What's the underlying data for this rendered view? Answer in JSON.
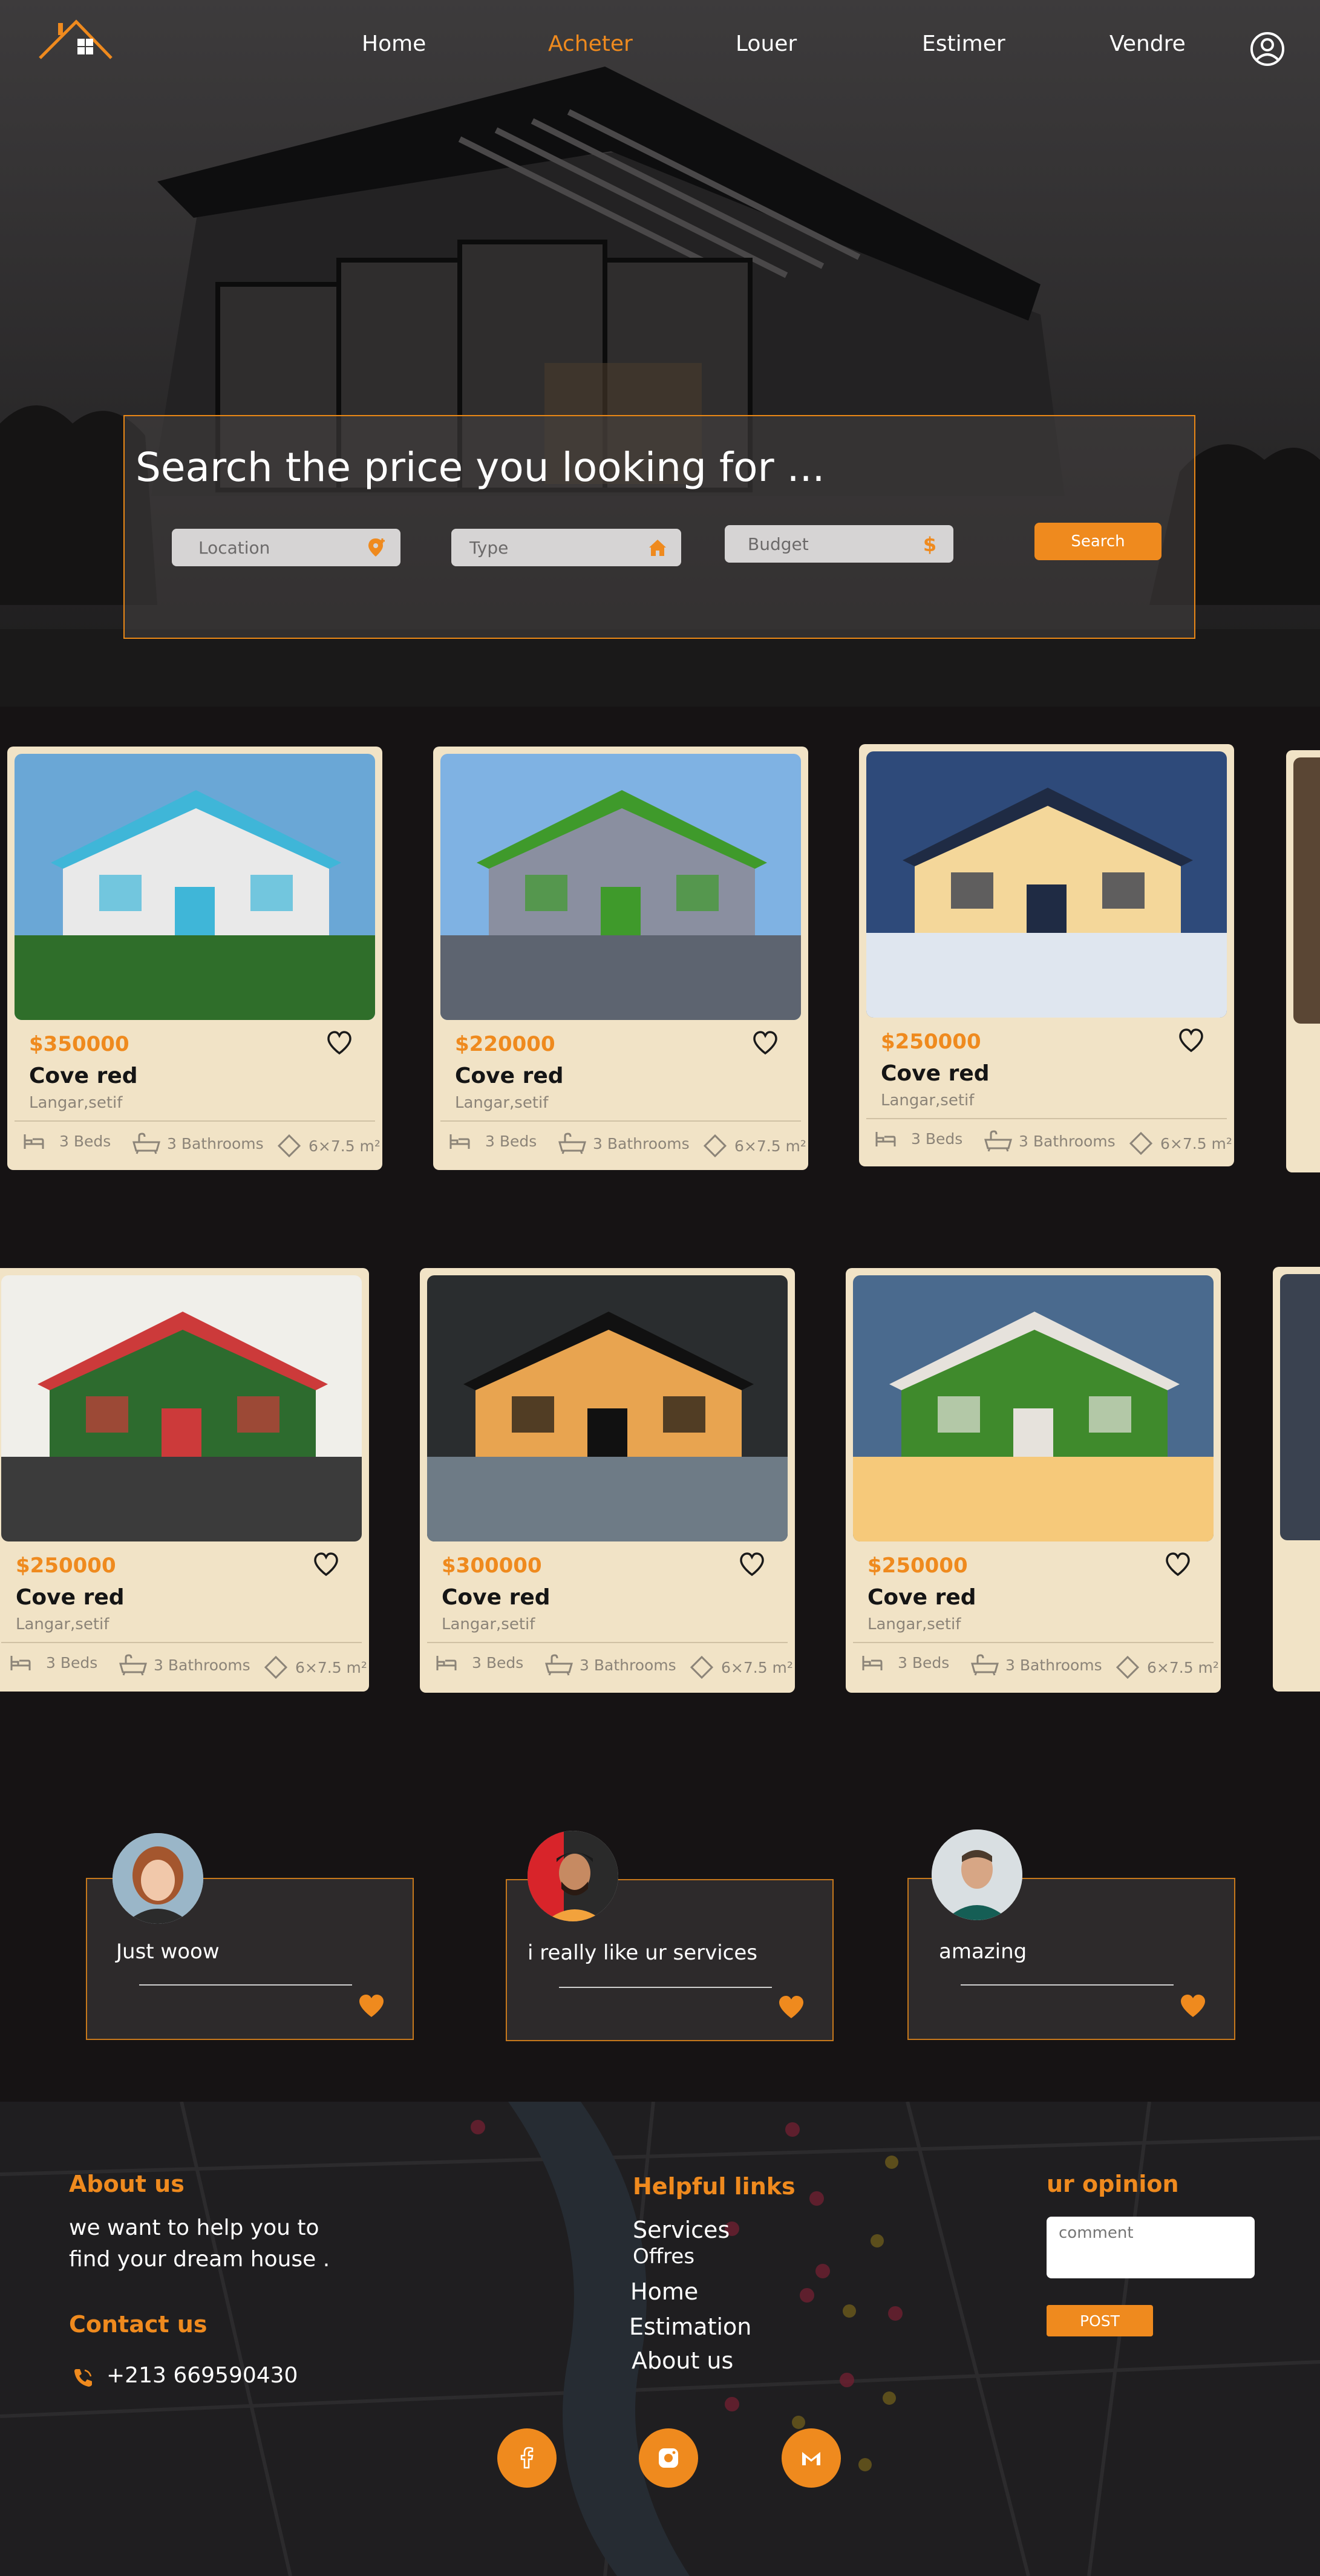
{
  "nav": {
    "links": [
      "Home",
      "Acheter",
      "Louer",
      "Estimer",
      "Vendre"
    ],
    "active": "Acheter"
  },
  "search": {
    "title": "Search  the price you looking for ...",
    "location_placeholder": "Location",
    "type_placeholder": "Type",
    "budget_placeholder": "Budget",
    "button": "Search"
  },
  "listings": [
    {
      "price": "$350000",
      "name": "Cove red",
      "location": "Langar,setif",
      "beds": "3 Beds",
      "baths": "3 Bathrooms",
      "area": "6×7.5 m²"
    },
    {
      "price": "$220000",
      "name": "Cove red",
      "location": "Langar,setif",
      "beds": "3 Beds",
      "baths": "3 Bathrooms",
      "area": "6×7.5 m²"
    },
    {
      "price": "$250000",
      "name": "Cove red",
      "location": "Langar,setif",
      "beds": "3 Beds",
      "baths": "3 Bathrooms",
      "area": "6×7.5 m²"
    },
    {
      "price": "$250000",
      "name": "Cove red",
      "location": "Langar,setif",
      "beds": "3 Beds",
      "baths": "3 Bathrooms",
      "area": "6×7.5 m²"
    },
    {
      "price": "$300000",
      "name": "Cove red",
      "location": "Langar,setif",
      "beds": "3 Beds",
      "baths": "3 Bathrooms",
      "area": "6×7.5 m²"
    },
    {
      "price": "$250000",
      "name": "Cove red",
      "location": "Langar,setif",
      "beds": "3 Beds",
      "baths": "3 Bathrooms",
      "area": "6×7.5 m²"
    }
  ],
  "testimonials": [
    {
      "text": "Just woow"
    },
    {
      "text": "i really like ur services"
    },
    {
      "text": "amazing"
    }
  ],
  "footer": {
    "about_title": "About us",
    "about_text_1": "we want to help you to",
    "about_text_2": "find your dream house .",
    "contact_title": "Contact us",
    "phone": "+213 669590430",
    "links_title": "Helpful links",
    "links": [
      "Services",
      "Offres",
      "Home",
      "Estimation",
      "About us"
    ],
    "opinion_title": "ur opinion",
    "comment_placeholder": "comment",
    "post_button": "POST"
  },
  "colors": {
    "accent": "#ef8a1e",
    "card_bg": "#f1e3c6",
    "page_bg": "#161314"
  },
  "icons": [
    "house-logo-icon",
    "user-circle-icon",
    "location-pin-icon",
    "home-icon",
    "dollar-icon",
    "heart-icon",
    "bed-icon",
    "bathtub-icon",
    "area-icon",
    "phone-icon",
    "facebook-icon",
    "instagram-icon",
    "gmail-icon"
  ]
}
